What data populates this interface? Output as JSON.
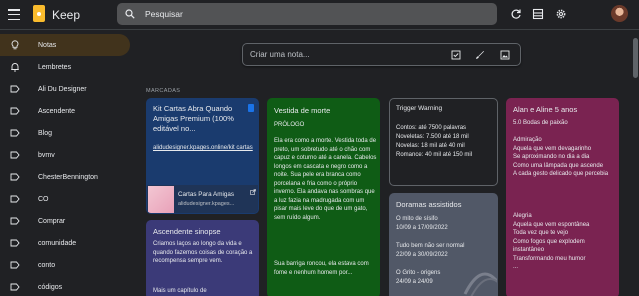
{
  "header": {
    "app_title": "Keep",
    "search_placeholder": "Pesquisar",
    "icons": [
      "menu-icon",
      "keep-logo",
      "search-icon",
      "refresh-icon",
      "list-view-icon",
      "settings-icon",
      "avatar"
    ]
  },
  "sidebar": {
    "items": [
      {
        "label": "Notas",
        "icon": "lightbulb-icon",
        "active": true
      },
      {
        "label": "Lembretes",
        "icon": "bell-icon"
      },
      {
        "label": "Ali Du Designer",
        "icon": "label-icon"
      },
      {
        "label": "Ascendente",
        "icon": "label-icon"
      },
      {
        "label": "Blog",
        "icon": "label-icon"
      },
      {
        "label": "bvmv",
        "icon": "label-icon"
      },
      {
        "label": "ChesterBennington",
        "icon": "label-icon"
      },
      {
        "label": "CO",
        "icon": "label-icon"
      },
      {
        "label": "Comprar",
        "icon": "label-icon"
      },
      {
        "label": "comunidade",
        "icon": "label-icon"
      },
      {
        "label": "conto",
        "icon": "label-icon"
      },
      {
        "label": "códigos",
        "icon": "label-icon"
      }
    ]
  },
  "create_note": {
    "placeholder": "Criar uma nota...",
    "icons": [
      "checkbox-icon",
      "brush-icon",
      "image-icon"
    ]
  },
  "pinned_label": "MARCADAS",
  "notes": {
    "kit": {
      "title": "Kit Cartas Abra Quando Amigas Premium (100% editável no...",
      "link": "alidudesigner.kpages.online/kit cartas",
      "card_title": "Cartas Para Amigas",
      "card_url": "alidudesigner.kpages..."
    },
    "ascendente": {
      "title": "Ascendente sinopse",
      "text": "Criamos laços ao longo da vida e quando fazemos coisas de coração a recompensa sempre vem.",
      "text2": "Mais um capítulo de"
    },
    "vestida": {
      "title": "Vestida de morte",
      "subtitle": "PRÓLOGO",
      "p1": "Ela era como a morte. Vestida toda de preto, um sobretudo até o chão com capuz e coturno até a canela. Cabelos longos em cascata e negro como a noite. Sua pele era branca como porcelana e fria como o próprio inverno. Ela andava nas sombras que a luz fazia na madrugada com um pisar mais leve do que de um gato, sem ruído algum.",
      "p2": "Sua barriga roncou, ela estava com fome e nenhum homem por..."
    },
    "trigger": {
      "title": "Trigger Warning",
      "lines": [
        "Contos: até 7500 palavras",
        "Noveletas: 7.500 até 18 mil",
        "Novelas: 18 mil até 40 mil",
        "Romance: 40 mil até 150 mil"
      ]
    },
    "doramas": {
      "title": "Doramas assistidos",
      "lines": [
        "O mito de sísifo",
        "10/09 a 17/09/2022",
        "",
        "Tudo bem não ser normal",
        "22/09 a 30/09/2022",
        "",
        "O Grito - origens",
        "24/09 a 24/09"
      ]
    },
    "alan": {
      "title": "Alan e Aline 5 anos",
      "subtitle": "5.0 Bodas de paixão",
      "lines": [
        "Admiração",
        "Aquela que vem devagarinho",
        "Se aproximando no dia a dia",
        "Como uma lâmpada que ascende",
        "A cada gesto delicado que percebia",
        "",
        "Alegria",
        "Aquela que vem espontânea",
        "Toda vez que te vejo",
        "Como fogos que explodem instantâneo",
        "Transformando meu humor",
        "..."
      ]
    }
  },
  "colors": {
    "bg": "#202124",
    "keep_yellow": "#f9bb2d",
    "active_nav": "#41331c",
    "kit_note": "#1a3b6e",
    "ascendente_note": "#3b3a78",
    "vestida_note": "#0f5c15",
    "doramas_note": "#515867",
    "alan_note": "#7a2351"
  }
}
